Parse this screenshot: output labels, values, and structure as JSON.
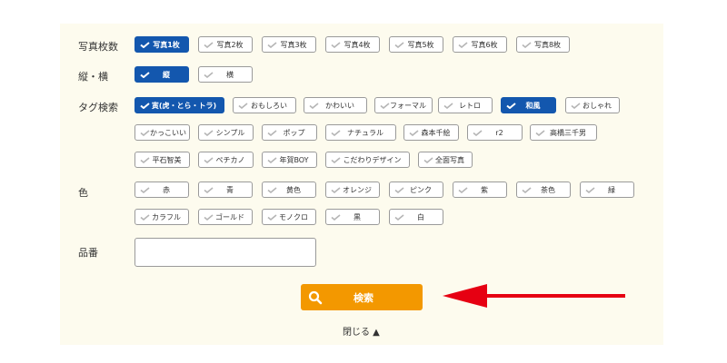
{
  "labels": {
    "photos": "写真枚数",
    "orientation": "縦・横",
    "tags": "タグ検索",
    "color": "色",
    "product_no": "品番"
  },
  "photos": [
    {
      "label": "写真1枚",
      "checked": true
    },
    {
      "label": "写真2枚",
      "checked": false
    },
    {
      "label": "写真3枚",
      "checked": false
    },
    {
      "label": "写真4枚",
      "checked": false
    },
    {
      "label": "写真5枚",
      "checked": false
    },
    {
      "label": "写真6枚",
      "checked": false
    },
    {
      "label": "写真8枚",
      "checked": false
    }
  ],
  "orientation": [
    {
      "label": "縦",
      "checked": true
    },
    {
      "label": "横",
      "checked": false
    }
  ],
  "tags": [
    {
      "label": "寅(虎・とら・トラ)",
      "checked": true
    },
    {
      "label": "おもしろい",
      "checked": false
    },
    {
      "label": "かわいい",
      "checked": false
    },
    {
      "label": "フォーマル",
      "checked": false
    },
    {
      "label": "レトロ",
      "checked": false
    },
    {
      "label": "和風",
      "checked": true
    },
    {
      "label": "おしゃれ",
      "checked": false
    },
    {
      "label": "かっこいい",
      "checked": false
    },
    {
      "label": "シンプル",
      "checked": false
    },
    {
      "label": "ポップ",
      "checked": false
    },
    {
      "label": "ナチュラル",
      "checked": false
    },
    {
      "label": "森本千絵",
      "checked": false
    },
    {
      "label": "r2",
      "checked": false
    },
    {
      "label": "高橋三千男",
      "checked": false
    },
    {
      "label": "平石智美",
      "checked": false
    },
    {
      "label": "ペチカノ",
      "checked": false
    },
    {
      "label": "年賀BOY",
      "checked": false
    },
    {
      "label": "こだわりデザイン",
      "checked": false
    },
    {
      "label": "全面写真",
      "checked": false
    }
  ],
  "colors": [
    {
      "label": "赤",
      "checked": false
    },
    {
      "label": "青",
      "checked": false
    },
    {
      "label": "黄色",
      "checked": false
    },
    {
      "label": "オレンジ",
      "checked": false
    },
    {
      "label": "ピンク",
      "checked": false
    },
    {
      "label": "紫",
      "checked": false
    },
    {
      "label": "茶色",
      "checked": false
    },
    {
      "label": "緑",
      "checked": false
    },
    {
      "label": "カラフル",
      "checked": false
    },
    {
      "label": "ゴールド",
      "checked": false
    },
    {
      "label": "モノクロ",
      "checked": false
    },
    {
      "label": "黒",
      "checked": false
    },
    {
      "label": "白",
      "checked": false
    }
  ],
  "product_input": {
    "value": "",
    "placeholder": ""
  },
  "search_button": {
    "label": "検索",
    "icon": "search-icon"
  },
  "close_link": {
    "label": "閉じる ▲"
  },
  "annotation": {
    "arrow_color": "#e60012"
  },
  "theme": {
    "panel_bg": "#fdfbee",
    "selected": "#1357ae",
    "button": "#f39800"
  }
}
